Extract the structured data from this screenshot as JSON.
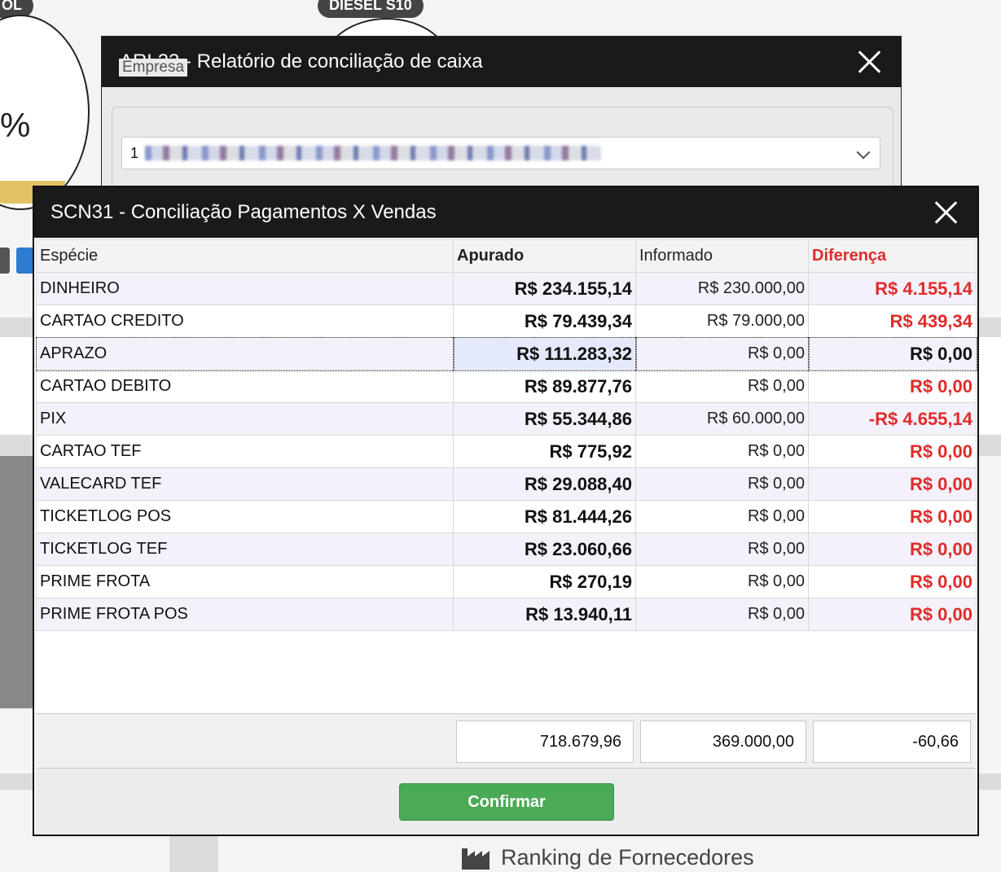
{
  "background": {
    "pills": [
      "OL",
      "DIESEL S10"
    ],
    "gauge_percent_text": "%",
    "ranking_label": "Ranking de Fornecedores"
  },
  "arl33": {
    "title": "ARL33 - Relatório de conciliação de caixa",
    "empresa_legend": "Empresa",
    "empresa_value": "1"
  },
  "scn31": {
    "title": "SCN31 - Conciliação Pagamentos X Vendas",
    "columns": [
      "Espécie",
      "Apurado",
      "Informado",
      "Diferença"
    ],
    "rows": [
      {
        "especie": "DINHEIRO",
        "apurado": "R$ 234.155,14",
        "informado": "R$ 230.000,00",
        "diferenca": "R$ 4.155,14"
      },
      {
        "especie": "CARTAO CREDITO",
        "apurado": "R$ 79.439,34",
        "informado": "R$ 79.000,00",
        "diferenca": "R$ 439,34"
      },
      {
        "especie": "APRAZO",
        "apurado": "R$ 111.283,32",
        "informado": "R$ 0,00",
        "diferenca": "R$ 0,00"
      },
      {
        "especie": "CARTAO DEBITO",
        "apurado": "R$ 89.877,76",
        "informado": "R$ 0,00",
        "diferenca": "R$ 0,00"
      },
      {
        "especie": "PIX",
        "apurado": "R$ 55.344,86",
        "informado": "R$ 60.000,00",
        "diferenca": "-R$ 4.655,14"
      },
      {
        "especie": "CARTAO TEF",
        "apurado": "R$ 775,92",
        "informado": "R$ 0,00",
        "diferenca": "R$ 0,00"
      },
      {
        "especie": "VALECARD TEF",
        "apurado": "R$ 29.088,40",
        "informado": "R$ 0,00",
        "diferenca": "R$ 0,00"
      },
      {
        "especie": "TICKETLOG POS",
        "apurado": "R$ 81.444,26",
        "informado": "R$ 0,00",
        "diferenca": "R$ 0,00"
      },
      {
        "especie": "TICKETLOG TEF",
        "apurado": "R$ 23.060,66",
        "informado": "R$ 0,00",
        "diferenca": "R$ 0,00"
      },
      {
        "especie": "PRIME FROTA",
        "apurado": "R$ 270,19",
        "informado": "R$ 0,00",
        "diferenca": "R$ 0,00"
      },
      {
        "especie": "PRIME FROTA POS",
        "apurado": "R$ 13.940,11",
        "informado": "R$ 0,00",
        "diferenca": "R$ 0,00"
      }
    ],
    "selected_row": 2,
    "totals": {
      "apurado": "718.679,96",
      "informado": "369.000,00",
      "diferenca": "-60,66"
    },
    "confirm_label": "Confirmar"
  },
  "colors": {
    "titlebar": "#1a1a1a",
    "negative_red": "#e02b2b",
    "confirm_green": "#4aaa55",
    "selected_cell": "#e4e9fb"
  }
}
